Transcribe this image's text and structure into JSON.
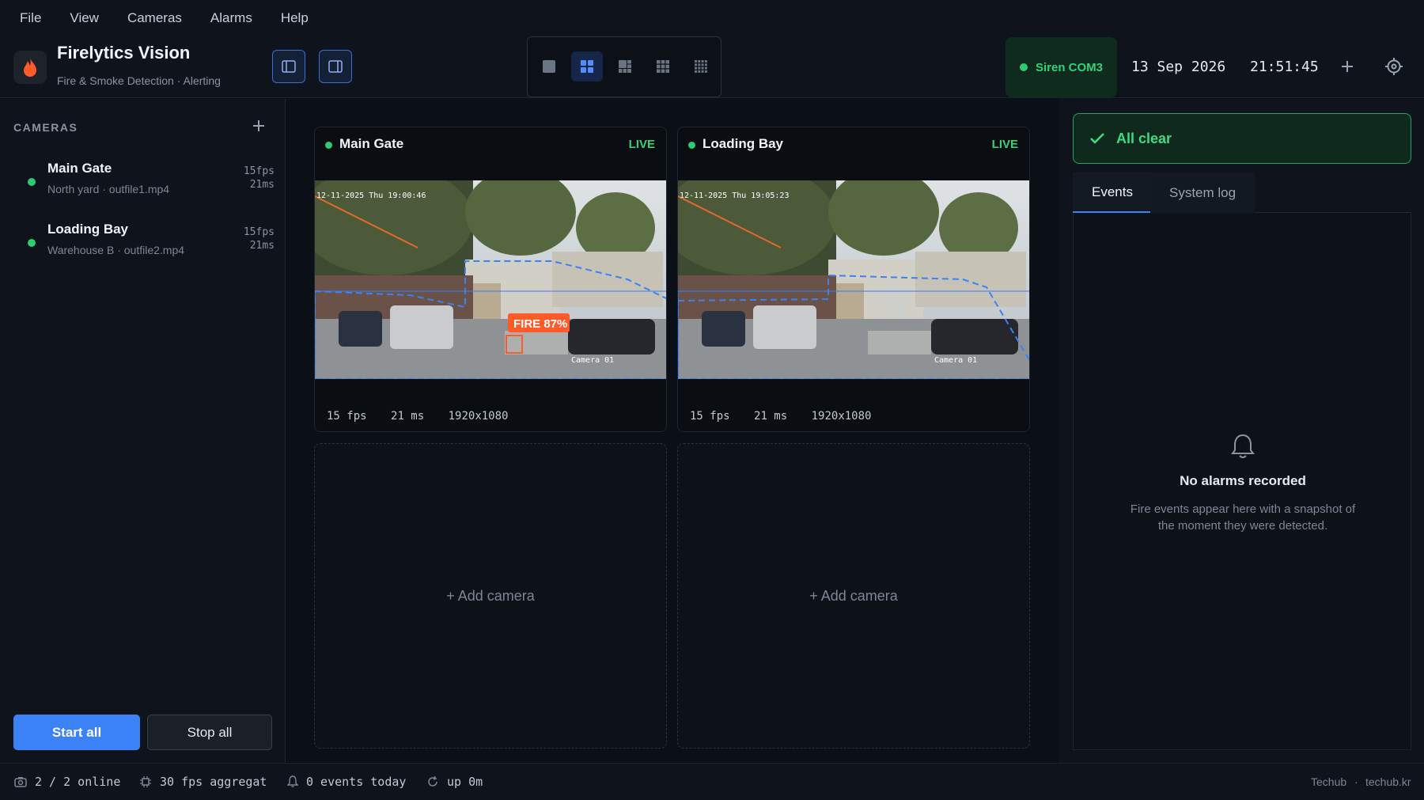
{
  "menu": [
    "File",
    "View",
    "Cameras",
    "Alarms",
    "Help"
  ],
  "app": {
    "title": "Firelytics Vision",
    "subtitle": "Fire & Smoke Detection · Alerting"
  },
  "header": {
    "siren_label": "Siren COM3",
    "date": "13 Sep 2026",
    "time": "21:51:45",
    "layout_active": "2x2"
  },
  "sidebar": {
    "heading": "CAMERAS",
    "cameras": [
      {
        "name": "Main Gate",
        "source": "North yard · outfile1.mp4",
        "fps": "15fps",
        "latency": "21ms",
        "status": "online"
      },
      {
        "name": "Loading Bay",
        "source": "Warehouse B · outfile2.mp4",
        "fps": "15fps",
        "latency": "21ms",
        "status": "online"
      }
    ],
    "start_all": "Start all",
    "stop_all": "Stop all"
  },
  "grid": {
    "tiles": [
      {
        "name": "Main Gate",
        "live": "LIVE",
        "stats": [
          "15 fps",
          "21 ms",
          "1920x1080"
        ],
        "overlay_ts": "12-11-2025 Thu 19:00:46",
        "overlay_cam": "Camera 01",
        "detection": "FIRE 87%"
      },
      {
        "name": "Loading Bay",
        "live": "LIVE",
        "stats": [
          "15 fps",
          "21 ms",
          "1920x1080"
        ],
        "overlay_ts": "12-11-2025 Thu 19:05:23",
        "overlay_cam": "Camera 01"
      }
    ],
    "empty_label": "+ Add camera"
  },
  "right": {
    "status": "All clear",
    "tabs": [
      "Events",
      "System log"
    ],
    "empty_title": "No alarms recorded",
    "empty_text": "Fire events appear here with a snapshot of the moment they were detected."
  },
  "statusbar": {
    "online": "2 / 2 online",
    "fps": "30 fps aggregat",
    "events": "0 events today",
    "uptime": "up 0m",
    "brand": "Techub",
    "sep": "·",
    "site": "techub.kr"
  },
  "colors": {
    "accent": "#3b82f6",
    "live": "#34d27a",
    "fire": "#ff5a2a",
    "zone": "#3b82f6"
  }
}
